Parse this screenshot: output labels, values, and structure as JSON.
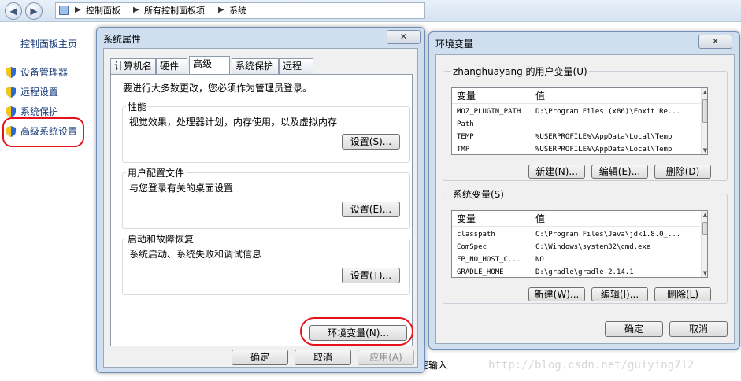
{
  "explorer": {
    "breadcrumb": [
      "控制面板",
      "所有控制面板项",
      "系统"
    ],
    "left_panel": {
      "title": "控制面板主页",
      "items": [
        {
          "label": "设备管理器",
          "icon": "shield-icon"
        },
        {
          "label": "远程设置",
          "icon": "shield-icon"
        },
        {
          "label": "系统保护",
          "icon": "shield-icon"
        },
        {
          "label": "高级系统设置",
          "icon": "shield-icon"
        }
      ]
    },
    "behind_text": "控输入"
  },
  "system_properties": {
    "title": "系统属性",
    "close_label": "✕",
    "tabs": [
      "计算机名",
      "硬件",
      "高级",
      "系统保护",
      "远程"
    ],
    "active_tab": "高级",
    "admin_note": "要进行大多数更改，您必须作为管理员登录。",
    "groups": [
      {
        "title": "性能",
        "desc": "视觉效果，处理器计划，内存使用，以及虚拟内存",
        "button": "设置(S)..."
      },
      {
        "title": "用户配置文件",
        "desc": "与您登录有关的桌面设置",
        "button": "设置(E)..."
      },
      {
        "title": "启动和故障恢复",
        "desc": "系统启动、系统失败和调试信息",
        "button": "设置(T)..."
      }
    ],
    "env_button": "环境变量(N)...",
    "ok": "确定",
    "cancel": "取消",
    "apply": "应用(A)"
  },
  "env_vars": {
    "title": "环境变量",
    "close_label": "✕",
    "user_section": "zhanghuayang 的用户变量(U)",
    "col_var": "变量",
    "col_val": "值",
    "user_rows": [
      {
        "name": "MOZ_PLUGIN_PATH",
        "value": "D:\\Program Files (x86)\\Foxit Re..."
      },
      {
        "name": "Path",
        "value": ""
      },
      {
        "name": "TEMP",
        "value": "%USERPROFILE%\\AppData\\Local\\Temp"
      },
      {
        "name": "TMP",
        "value": "%USERPROFILE%\\AppData\\Local\\Temp"
      }
    ],
    "user_buttons": {
      "new": "新建(N)...",
      "edit": "编辑(E)...",
      "delete": "删除(D)"
    },
    "system_section": "系统变量(S)",
    "system_rows": [
      {
        "name": "classpath",
        "value": "C:\\Program Files\\Java\\jdk1.8.0_..."
      },
      {
        "name": "ComSpec",
        "value": "C:\\Windows\\system32\\cmd.exe"
      },
      {
        "name": "FP_NO_HOST_C...",
        "value": "NO"
      },
      {
        "name": "GRADLE_HOME",
        "value": "D:\\gradle\\gradle-2.14.1"
      }
    ],
    "system_buttons": {
      "new": "新建(W)...",
      "edit": "编辑(I)...",
      "delete": "删除(L)"
    },
    "ok": "确定",
    "cancel": "取消"
  },
  "watermark": "http://blog.csdn.net/guiying712"
}
